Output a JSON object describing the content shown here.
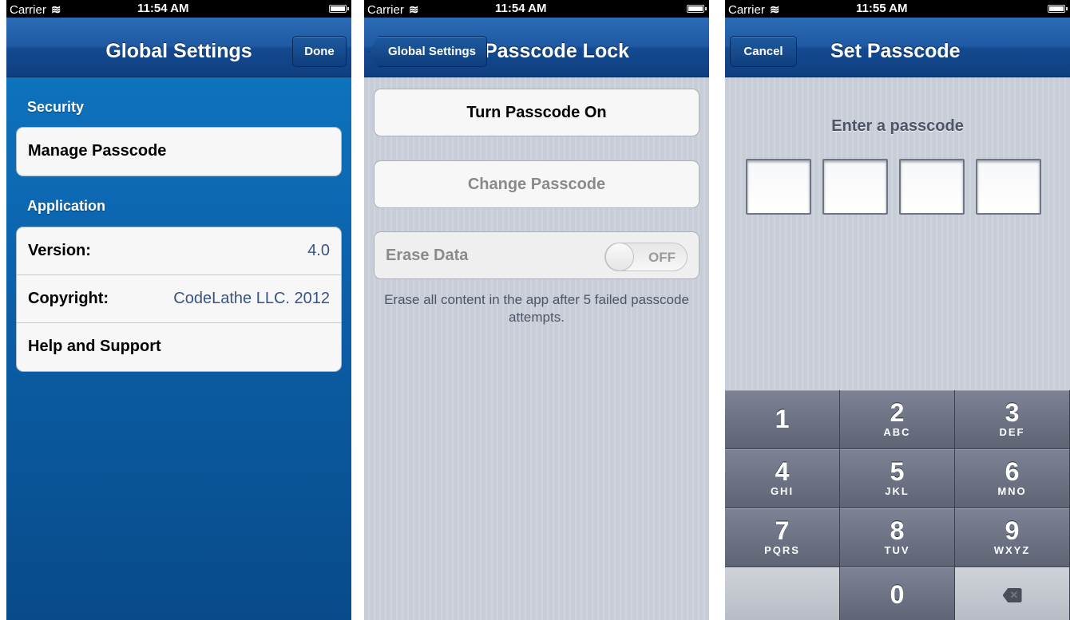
{
  "screens": [
    {
      "status": {
        "carrier": "Carrier",
        "time": "11:54 AM"
      },
      "nav": {
        "title": "Global Settings",
        "right_button": "Done"
      },
      "sections": {
        "security": "Security",
        "manage_passcode": "Manage Passcode",
        "application": "Application",
        "version_label": "Version:",
        "version_value": "4.0",
        "copyright_label": "Copyright:",
        "copyright_value": "CodeLathe LLC. 2012",
        "help": "Help and Support"
      }
    },
    {
      "status": {
        "carrier": "Carrier",
        "time": "11:54 AM"
      },
      "nav": {
        "title": "Passcode Lock",
        "back_button": "Global Settings"
      },
      "buttons": {
        "turn_on": "Turn Passcode On",
        "change": "Change Passcode"
      },
      "erase": {
        "label": "Erase Data",
        "toggle": "OFF"
      },
      "footnote": "Erase all content in the app after 5 failed passcode attempts."
    },
    {
      "status": {
        "carrier": "Carrier",
        "time": "11:55 AM"
      },
      "nav": {
        "title": "Set Passcode",
        "left_button": "Cancel"
      },
      "prompt": "Enter a passcode",
      "keys": [
        {
          "num": "1",
          "sub": ""
        },
        {
          "num": "2",
          "sub": "ABC"
        },
        {
          "num": "3",
          "sub": "DEF"
        },
        {
          "num": "4",
          "sub": "GHI"
        },
        {
          "num": "5",
          "sub": "JKL"
        },
        {
          "num": "6",
          "sub": "MNO"
        },
        {
          "num": "7",
          "sub": "PQRS"
        },
        {
          "num": "8",
          "sub": "TUV"
        },
        {
          "num": "9",
          "sub": "WXYZ"
        },
        {
          "num": "0",
          "sub": ""
        }
      ]
    }
  ]
}
